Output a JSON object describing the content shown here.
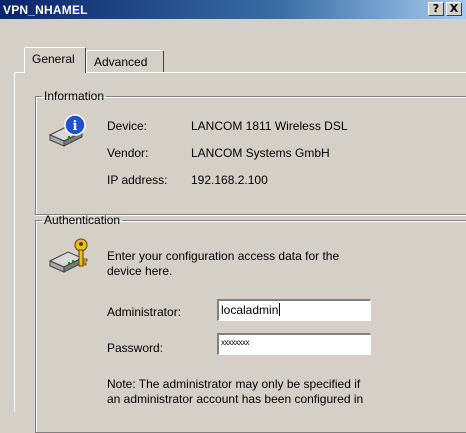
{
  "window": {
    "title": "VPN_NHAMEL",
    "help_glyph": "?",
    "close_glyph": "X"
  },
  "tabs": [
    {
      "label": "General",
      "active": true
    },
    {
      "label": "Advanced",
      "active": false
    }
  ],
  "information": {
    "legend": "Information",
    "device_label": "Device:",
    "device_value": "LANCOM 1811 Wireless DSL",
    "vendor_label": "Vendor:",
    "vendor_value": "LANCOM Systems GmbH",
    "ip_label": "IP address:",
    "ip_value": "192.168.2.100",
    "icon": "info-device-icon"
  },
  "authentication": {
    "legend": "Authentication",
    "instruction_line1": "Enter your configuration access data for the",
    "instruction_line2": "device here.",
    "admin_label": "Administrator:",
    "admin_value": "localadmin",
    "password_label": "Password:",
    "password_value": "xxxxxxxx",
    "note_line1": "Note: The administrator may only be specified if",
    "note_line2": "an administrator account has been configured in",
    "icon": "key-device-icon"
  },
  "colors": {
    "title_gradient_start": "#0a246a",
    "title_gradient_end": "#a6caf0",
    "face": "#d4d0c8"
  }
}
